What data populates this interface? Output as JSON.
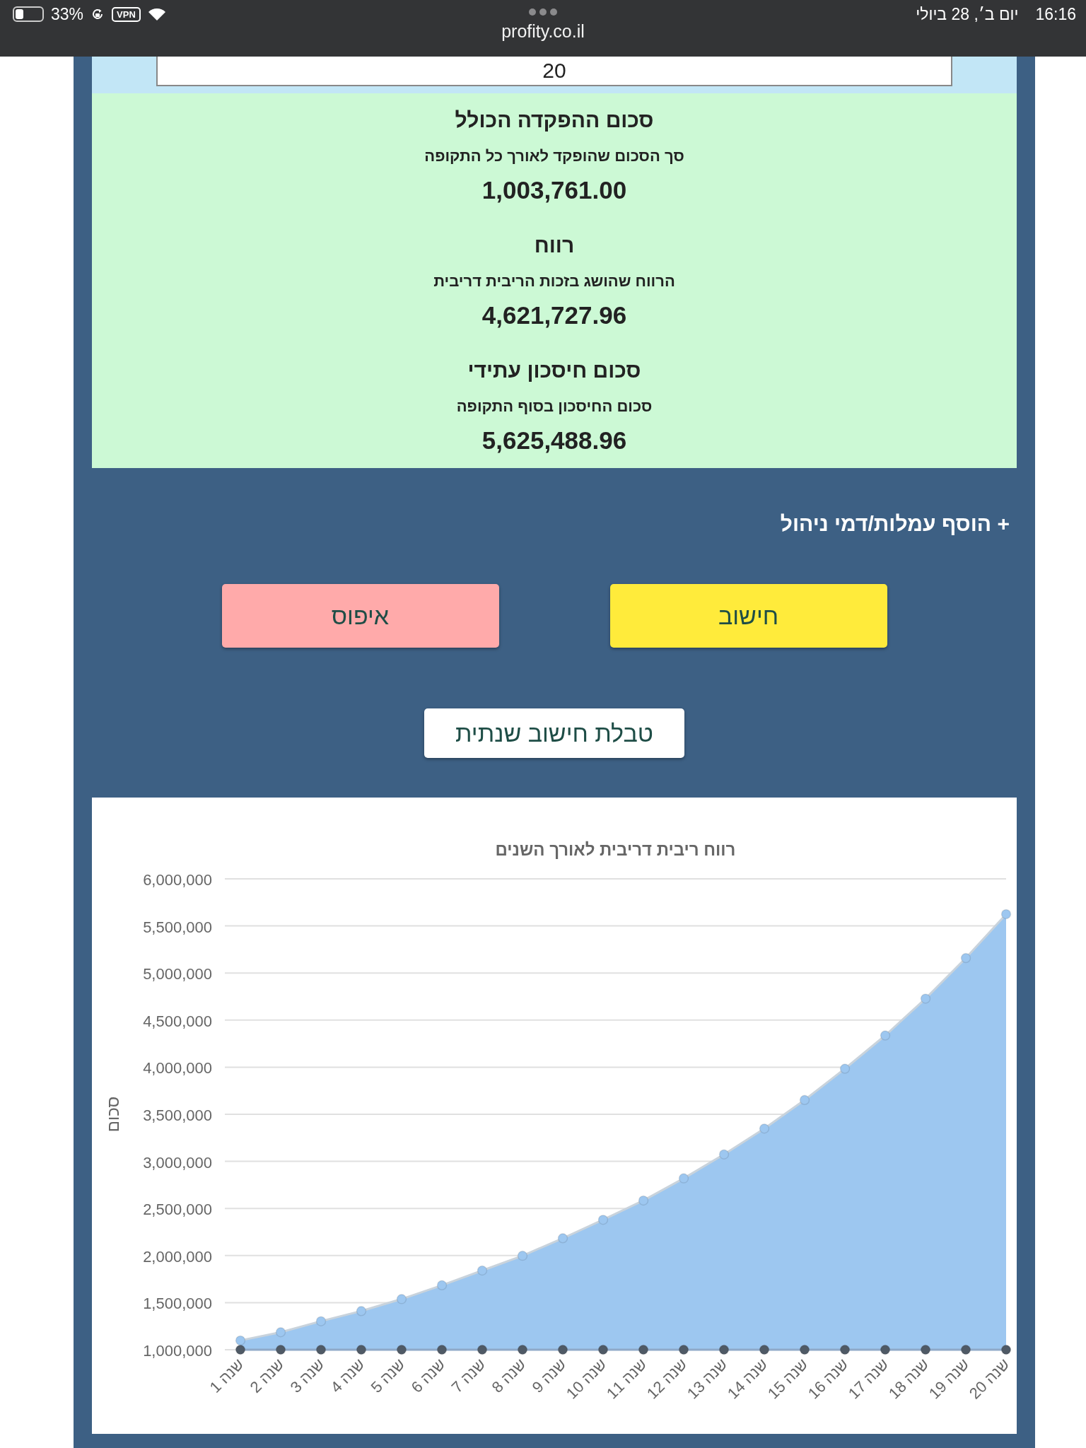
{
  "status_bar": {
    "battery": "33%",
    "vpn": "VPN",
    "url": "profity.co.il",
    "date": "יום ב׳, 28 ביולי",
    "time": "16:16"
  },
  "period_field": {
    "value": "20"
  },
  "results": [
    {
      "title": "סכום ההפקדה הכולל",
      "subtitle": "סך הסכום שהופקד לאורך כל התקופה",
      "value": "1,003,761.00"
    },
    {
      "title": "רווח",
      "subtitle": "הרווח שהושג בזכות הריבית דריבית",
      "value": "4,621,727.96"
    },
    {
      "title": "סכום חיסכון עתידי",
      "subtitle": "סכום החיסכון בסוף התקופה",
      "value": "5,625,488.96"
    }
  ],
  "fees_toggle": {
    "label": "+ הוסף עמלות/דמי ניהול"
  },
  "buttons": [
    {
      "label": "חישוב",
      "kind": "calculate"
    },
    {
      "label": "איפוס",
      "kind": "reset"
    }
  ],
  "table_button": {
    "label": "טבלת חישוב שנתית"
  },
  "chart": {
    "chart_data": {
      "type": "area",
      "title": "רווח ריבית דריבית לאורך השנים",
      "ylabel": "סכום",
      "categories": [
        "שנה 1",
        "שנה 2",
        "שנה 3",
        "שנה 4",
        "שנה 5",
        "שנה 6",
        "שנה 7",
        "שנה 8",
        "שנה 9",
        "שנה 10",
        "שנה 11",
        "שנה 12",
        "שנה 13",
        "שנה 14",
        "שנה 15",
        "שנה 16",
        "שנה 17",
        "שנה 18",
        "שנה 19",
        "שנה 20"
      ],
      "series": [
        {
          "type": "area",
          "marker": "circle",
          "color": "#9dc7f0",
          "values": [
            1098000,
            1186000,
            1303000,
            1411000,
            1538000,
            1685000,
            1841000,
            1998000,
            2184000,
            2380000,
            2585000,
            2820000,
            3074000,
            3348000,
            3652000,
            3984000,
            4337000,
            4728000,
            5159000,
            5625489
          ]
        },
        {
          "type": "line",
          "marker": "circle",
          "color": "#4f5a66",
          "values": [
            1000000,
            1000000,
            1000000,
            1000000,
            1000000,
            1000000,
            1000000,
            1000000,
            1000000,
            1000000,
            1000000,
            1000000,
            1000000,
            1000000,
            1000000,
            1000000,
            1000000,
            1000000,
            1000000,
            1000000
          ]
        }
      ],
      "ylim": [
        1000000,
        6000000
      ],
      "grid": true,
      "yticks": [
        {
          "value": 1000000,
          "label": "1,000,000"
        },
        {
          "value": 1500000,
          "label": "1,500,000"
        },
        {
          "value": 2000000,
          "label": "2,000,000"
        },
        {
          "value": 2500000,
          "label": "2,500,000"
        },
        {
          "value": 3000000,
          "label": "3,000,000"
        },
        {
          "value": 3500000,
          "label": "3,500,000"
        },
        {
          "value": 4000000,
          "label": "4,000,000"
        },
        {
          "value": 4500000,
          "label": "4,500,000"
        },
        {
          "value": 5000000,
          "label": "5,000,000"
        },
        {
          "value": 5500000,
          "label": "5,500,000"
        },
        {
          "value": 6000000,
          "label": "6,000,000"
        }
      ]
    }
  }
}
